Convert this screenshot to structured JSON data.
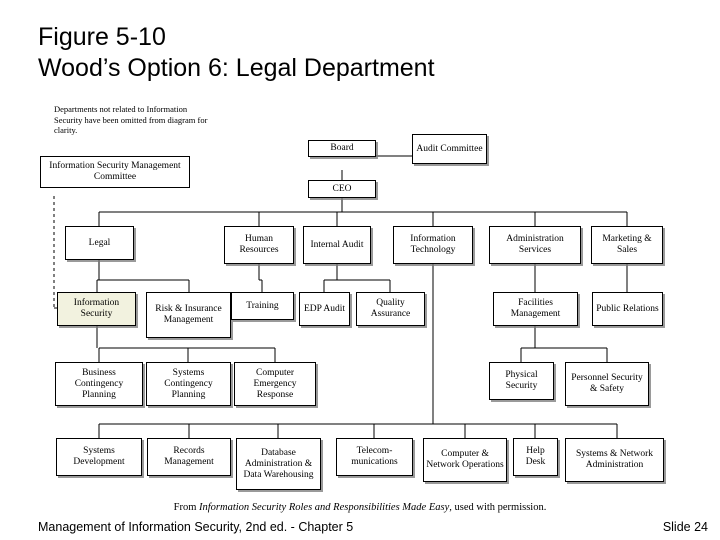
{
  "slide": {
    "title_line1": "Figure 5-10",
    "title_line2": "Wood’s Option 6: Legal Department"
  },
  "diagram": {
    "note": "Departments not related to Information Security have been omitted from diagram for clarity.",
    "highlight_color": "#f2f2df",
    "nodes": {
      "board": "Board",
      "audit_committee": "Audit Committee",
      "ceo": "CEO",
      "is_mgmt_committee": "Information Security Management Committee",
      "legal": "Legal",
      "human_resources": "Human Resources",
      "internal_audit": "Internal Audit",
      "information_technology": "Information Technology",
      "administration_services": "Administration Services",
      "marketing_sales": "Marketing & Sales",
      "information_security": "Information Security",
      "risk_insurance": "Risk & Insurance Management",
      "training": "Training",
      "edp_audit": "EDP Audit",
      "quality_assurance": "Quality Assurance",
      "facilities_management": "Facilities Management",
      "public_relations": "Public Relations",
      "business_contingency": "Business Contingency Planning",
      "systems_contingency": "Systems Contingency Planning",
      "computer_emergency": "Computer Emergency Response",
      "physical_security": "Physical Security",
      "personnel_security": "Personnel Security & Safety",
      "systems_development": "Systems Development",
      "records_management": "Records Management",
      "database_admin": "Database Administration & Data Warehousing",
      "telecommunications": "Telecom- munications",
      "computer_network_ops": "Computer & Network Operations",
      "help_desk": "Help Desk",
      "systems_network_admin": "Systems & Network Administration"
    }
  },
  "attribution": {
    "prefix": "From ",
    "book": "Information Security Roles and Responsibilities Made Easy",
    "suffix": ", used with permission."
  },
  "footer": {
    "left": "Management of Information Security, 2nd ed. - Chapter 5",
    "right": "Slide 24"
  }
}
